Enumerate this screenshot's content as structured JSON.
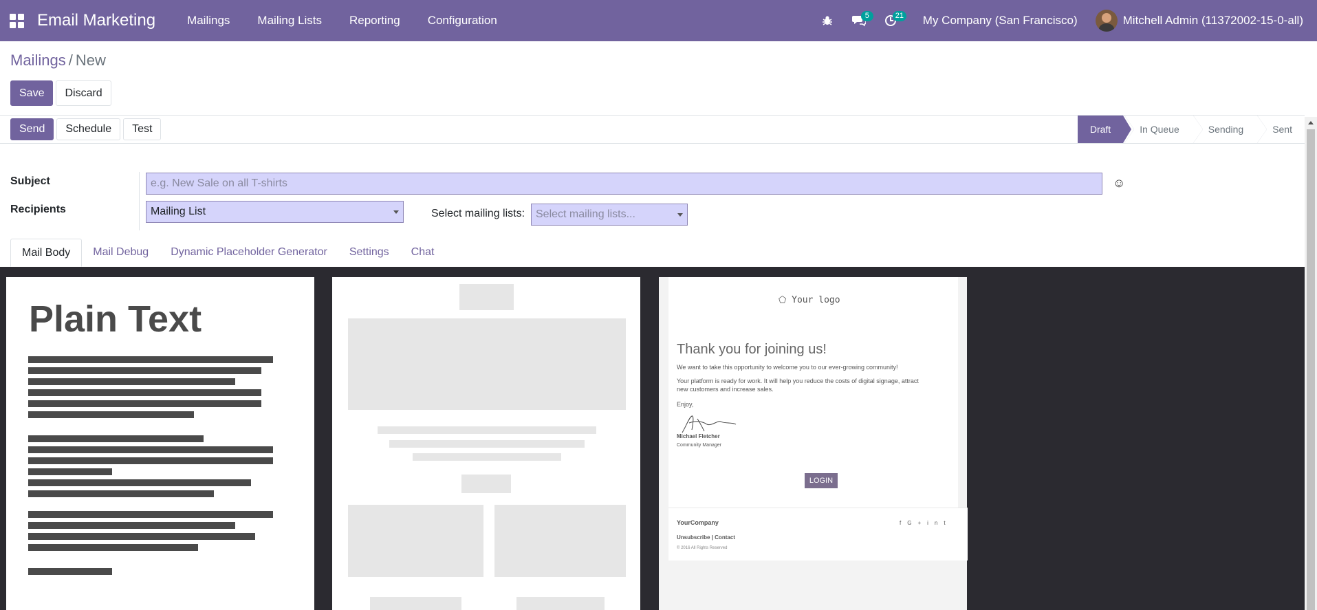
{
  "navbar": {
    "app_title": "Email Marketing",
    "menu": [
      "Mailings",
      "Mailing Lists",
      "Reporting",
      "Configuration"
    ],
    "messages_count": "5",
    "activities_count": "21",
    "company": "My Company (San Francisco)",
    "user": "Mitchell Admin (11372002-15-0-all)"
  },
  "breadcrumb": {
    "parent": "Mailings",
    "separator": "/",
    "current": "New"
  },
  "control_panel": {
    "save_label": "Save",
    "discard_label": "Discard"
  },
  "statusbar": {
    "actions": {
      "send": "Send",
      "schedule": "Schedule",
      "test": "Test"
    },
    "stages": [
      "Draft",
      "In Queue",
      "Sending",
      "Sent"
    ],
    "active_stage": "Draft"
  },
  "form": {
    "subject_label": "Subject",
    "subject_placeholder": "e.g. New Sale on all T-shirts",
    "recipients_label": "Recipients",
    "recipients_value": "Mailing List",
    "mailing_lists_label": "Select mailing lists:",
    "mailing_lists_placeholder": "Select mailing lists..."
  },
  "tabs": [
    "Mail Body",
    "Mail Debug",
    "Dynamic Placeholder Generator",
    "Settings",
    "Chat"
  ],
  "active_tab": "Mail Body",
  "templates": {
    "plain_text": {
      "title": "Plain Text"
    },
    "welcome": {
      "logo_text": "Your logo",
      "heading": "Thank you for joining us!",
      "line1": "We want to take this opportunity to welcome you to our ever-growing community!",
      "line2a": "Your platform is ready for work. It will help you reduce the costs of digital signage, attract",
      "line2b": "new customers and increase sales.",
      "enjoy": "Enjoy,",
      "signer_name": "Michael Fletcher",
      "signer_role": "Community Manager",
      "login_label": "LOGIN",
      "footer_company": "YourCompany",
      "unsubscribe": "Unsubscribe",
      "contact": "Contact",
      "copyright": "© 2016 All Rights Reserved",
      "social_icons": [
        "f",
        "G+",
        "in",
        "t"
      ]
    }
  },
  "colors": {
    "brand": "#71639e",
    "badge": "#00a09d",
    "field_bg": "#d5d4fb",
    "editor_bg": "#2b2a30"
  }
}
